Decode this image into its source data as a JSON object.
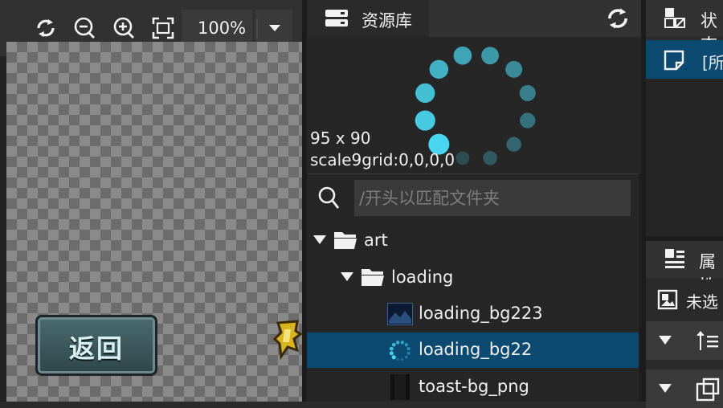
{
  "toolbar": {
    "zoom_value": "100%"
  },
  "canvas": {
    "back_button_label": "返回"
  },
  "resource_panel": {
    "title": "资源库",
    "preview": {
      "size_text": "95 x 90",
      "grid_text": "scale9grid:0,0,0,0"
    },
    "search": {
      "placeholder": "/开头以匹配文件夹"
    },
    "tree": [
      {
        "label": "art"
      },
      {
        "label": "loading"
      },
      {
        "label": "loading_bg223"
      },
      {
        "label": "loading_bg22"
      },
      {
        "label": "toast-bg_png"
      }
    ]
  },
  "state_panel": {
    "title": "状态",
    "item_label": "[所"
  },
  "property_panel": {
    "title": "属性",
    "unselected_label": "未选"
  },
  "colors": {
    "selection": "#0d4a72",
    "spinner": "#4ad6f0"
  }
}
